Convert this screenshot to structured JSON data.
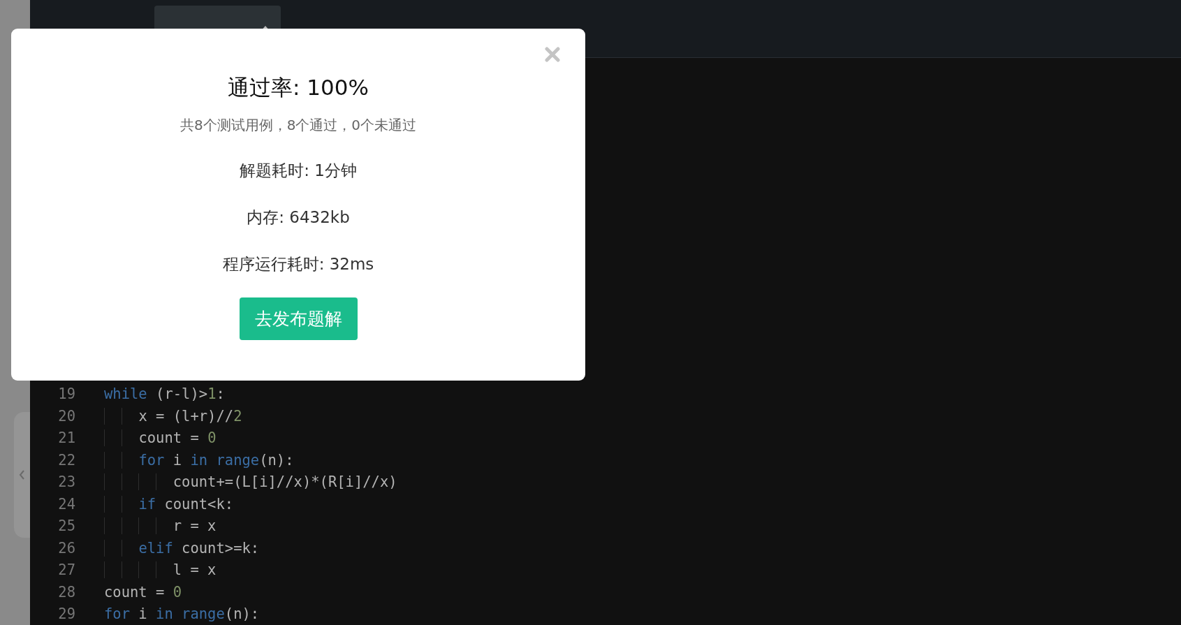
{
  "toolbar": {
    "language_select": {
      "expanded": false
    }
  },
  "editor": {
    "lines": [
      {
        "number": "19",
        "tokens": [
          {
            "kind": "keyword",
            "text": "while"
          },
          {
            "kind": "plain",
            "text": " (r-l)>"
          },
          {
            "kind": "number",
            "text": "1"
          },
          {
            "kind": "plain",
            "text": ":"
          }
        ]
      },
      {
        "number": "20",
        "tokens": [
          {
            "kind": "plain",
            "text": "    x = (l+r)//"
          },
          {
            "kind": "number",
            "text": "2"
          }
        ]
      },
      {
        "number": "21",
        "tokens": [
          {
            "kind": "plain",
            "text": "    count = "
          },
          {
            "kind": "number",
            "text": "0"
          }
        ]
      },
      {
        "number": "22",
        "tokens": [
          {
            "kind": "keyword",
            "text": "    for"
          },
          {
            "kind": "plain",
            "text": " i "
          },
          {
            "kind": "keyword",
            "text": "in range"
          },
          {
            "kind": "plain",
            "text": "(n):"
          }
        ]
      },
      {
        "number": "23",
        "tokens": [
          {
            "kind": "plain",
            "text": "        count+=(L[i]//x)*(R[i]//x)"
          }
        ]
      },
      {
        "number": "24",
        "tokens": [
          {
            "kind": "keyword",
            "text": "    if"
          },
          {
            "kind": "plain",
            "text": " count<k:"
          }
        ]
      },
      {
        "number": "25",
        "tokens": [
          {
            "kind": "plain",
            "text": "        r = x"
          }
        ]
      },
      {
        "number": "26",
        "tokens": [
          {
            "kind": "keyword",
            "text": "    elif"
          },
          {
            "kind": "plain",
            "text": " count>=k:"
          }
        ]
      },
      {
        "number": "27",
        "tokens": [
          {
            "kind": "plain",
            "text": "        l = x"
          }
        ]
      },
      {
        "number": "28",
        "tokens": [
          {
            "kind": "plain",
            "text": "count = "
          },
          {
            "kind": "number",
            "text": "0"
          }
        ]
      },
      {
        "number": "29",
        "tokens": [
          {
            "kind": "keyword",
            "text": "for"
          },
          {
            "kind": "plain",
            "text": " i "
          },
          {
            "kind": "keyword",
            "text": "in range"
          },
          {
            "kind": "plain",
            "text": "(n):"
          }
        ]
      }
    ]
  },
  "result_dialog": {
    "title": "通过率: 100%",
    "summary": "共8个测试用例，8个通过，0个未通过",
    "stats": [
      "解题耗时: 1分钟",
      "内存: 6432kb",
      "程序运行耗时: 32ms"
    ],
    "button": "去发布题解"
  }
}
